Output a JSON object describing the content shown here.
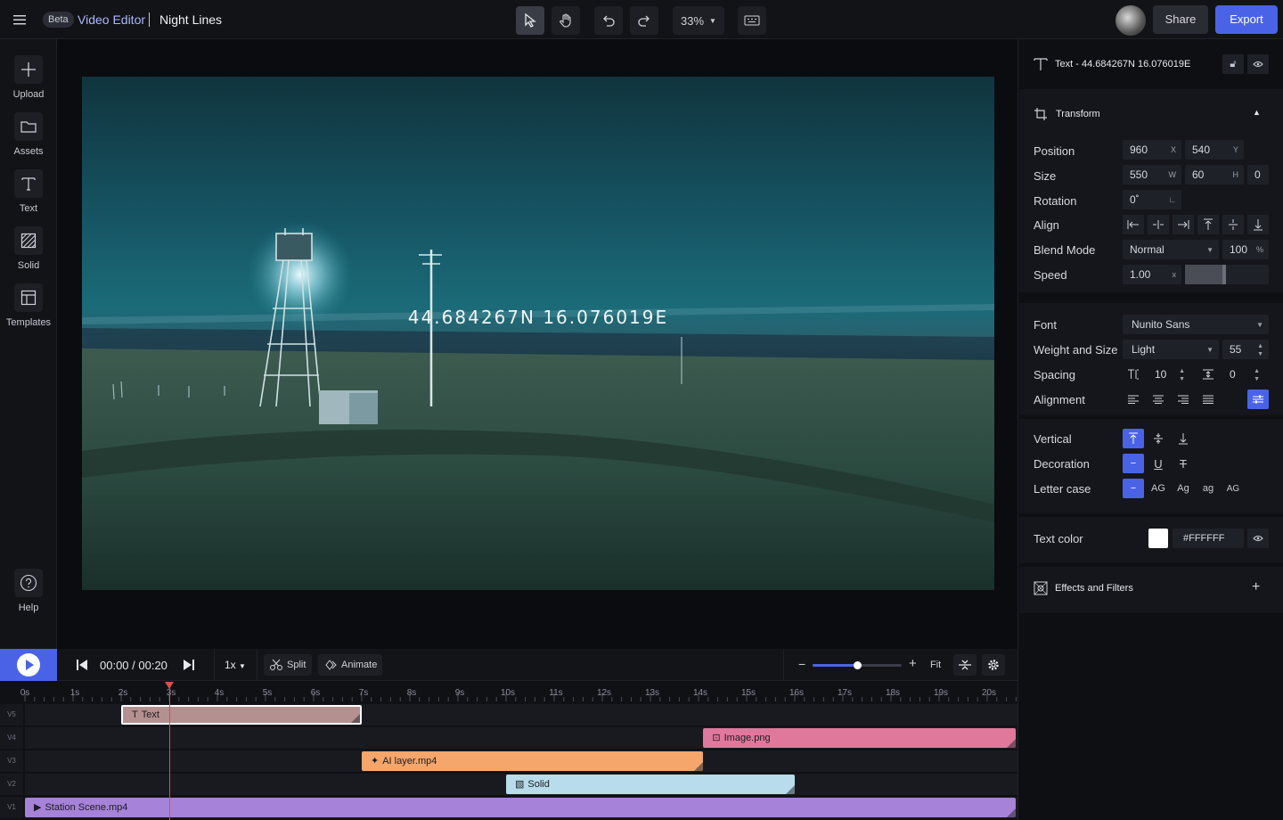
{
  "header": {
    "beta": "Beta",
    "app_name": "Video Editor",
    "project_name": "Night Lines",
    "zoom": "33%",
    "share_label": "Share",
    "export_label": "Export"
  },
  "leftnav": {
    "items": [
      {
        "label": "Upload",
        "icon": "plus-icon"
      },
      {
        "label": "Assets",
        "icon": "folder-icon"
      },
      {
        "label": "Text",
        "icon": "text-icon"
      },
      {
        "label": "Solid",
        "icon": "solid-icon"
      },
      {
        "label": "Templates",
        "icon": "templates-icon"
      }
    ],
    "help_label": "Help"
  },
  "preview": {
    "overlay_text": "44.684267N 16.076019E"
  },
  "inspector": {
    "title": "Text - 44.684267N 16.076019E",
    "transform_label": "Transform",
    "position_label": "Position",
    "position_x": "960",
    "position_y": "540",
    "size_label": "Size",
    "size_w": "550",
    "size_h": "60",
    "size_extra": "0",
    "rotation_label": "Rotation",
    "rotation": "0˚",
    "align_label": "Align",
    "blend_label": "Blend Mode",
    "blend_mode": "Normal",
    "opacity": "100",
    "speed_label": "Speed",
    "speed": "1.00",
    "font_label": "Font",
    "font": "Nunito Sans",
    "weight_label": "Weight and Size",
    "weight": "Light",
    "font_size": "55",
    "spacing_label": "Spacing",
    "letter_spacing": "10",
    "line_spacing": "0",
    "alignment_label": "Alignment",
    "vertical_label": "Vertical",
    "decoration_label": "Decoration",
    "lettercase_label": "Letter case",
    "case_options": [
      "AG",
      "Ag",
      "ag",
      "AG"
    ],
    "textcolor_label": "Text color",
    "text_color": "#FFFFFF",
    "effects_label": "Effects and Filters",
    "units": {
      "x": "X",
      "y": "Y",
      "w": "W",
      "h": "H",
      "speed_x": "x",
      "pct": "%"
    }
  },
  "timeline_bar": {
    "time": "00:00 / 00:20",
    "rate": "1x",
    "split_label": "Split",
    "animate_label": "Animate",
    "fit_label": "Fit"
  },
  "ruler": [
    "0s",
    "1s",
    "2s",
    "3s",
    "4s",
    "5s",
    "6s",
    "7s",
    "8s",
    "9s",
    "10s",
    "11s",
    "12s",
    "13s",
    "14s",
    "15s",
    "16s",
    "17s",
    "18s",
    "19s",
    "20s"
  ],
  "tracks": [
    {
      "id": "V5",
      "clip": "Text",
      "start": 2,
      "end": 7,
      "color": "#b59090"
    },
    {
      "id": "V4",
      "clip": "Image.png",
      "start": 14.1,
      "end": 20.6,
      "color": "#e0789c"
    },
    {
      "id": "V3",
      "clip": "AI layer.mp4",
      "start": 7,
      "end": 14.1,
      "color": "#f5a66a"
    },
    {
      "id": "V2",
      "clip": "Solid",
      "start": 10,
      "end": 16,
      "color": "#b8dcec"
    },
    {
      "id": "V1",
      "clip": "Station Scene.mp4",
      "start": 0,
      "end": 20.6,
      "color": "#a682d8"
    }
  ]
}
